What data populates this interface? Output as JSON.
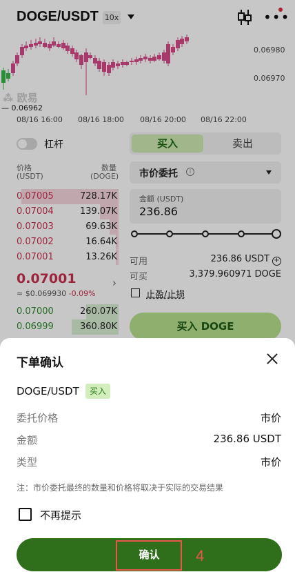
{
  "header": {
    "pair": "DOGE/USDT",
    "leverage_badge": "10x"
  },
  "chart": {
    "price_axis": [
      "0.06980",
      "0.06970"
    ],
    "time_axis": [
      "08/16 16:00",
      "08/16 18:00",
      "08/16 20:00",
      "08/16 22:00"
    ],
    "low_label": "— 0.06962",
    "watermark": "欧易",
    "colors": {
      "up": "#39b54a",
      "down": "#d64b8a"
    }
  },
  "leverage": {
    "label": "杠杆"
  },
  "orderbook": {
    "price_header": "价格",
    "price_unit": "(USDT)",
    "qty_header": "数量",
    "qty_unit": "(DOGE)",
    "asks": [
      {
        "price": "0.07005",
        "qty": "728.17K",
        "depth": 0.95
      },
      {
        "price": "0.07004",
        "qty": "139.07K",
        "depth": 0.18
      },
      {
        "price": "0.07003",
        "qty": "69.63K",
        "depth": 0.09
      },
      {
        "price": "0.07002",
        "qty": "16.64K",
        "depth": 0.03
      },
      {
        "price": "0.07001",
        "qty": "13.26K",
        "depth": 0.03
      }
    ],
    "mid_price": "0.07001",
    "mid_usd": "≈ $0.069930",
    "mid_change": "-0.09%",
    "bids": [
      {
        "price": "0.07000",
        "qty": "260.07K",
        "depth": 0.32
      },
      {
        "price": "0.06999",
        "qty": "360.80K",
        "depth": 0.46
      }
    ]
  },
  "trade_panel": {
    "buy_tab": "买入",
    "sell_tab": "卖出",
    "order_type": "市价委托",
    "amount_label": "金额 (USDT)",
    "amount_value": "236.86",
    "available_label": "可用",
    "available_value": "236.86 USDT",
    "can_buy_label": "可买",
    "can_buy_value": "3,379.960971 DOGE",
    "tpsl_label": "止盈/止损",
    "buy_button": "买入 DOGE"
  },
  "sheet": {
    "title": "下单确认",
    "pair": "DOGE/USDT",
    "side_badge": "买入",
    "rows": [
      {
        "key": "委托价格",
        "value": "市价"
      },
      {
        "key": "金额",
        "value": "236.86 USDT"
      },
      {
        "key": "类型",
        "value": "市价"
      }
    ],
    "note": "注：市价委托最终的数量和价格将取决于实际的交易结果",
    "dont_remind": "不再提示",
    "confirm_button": "确认"
  },
  "annotation": {
    "step": "4"
  }
}
